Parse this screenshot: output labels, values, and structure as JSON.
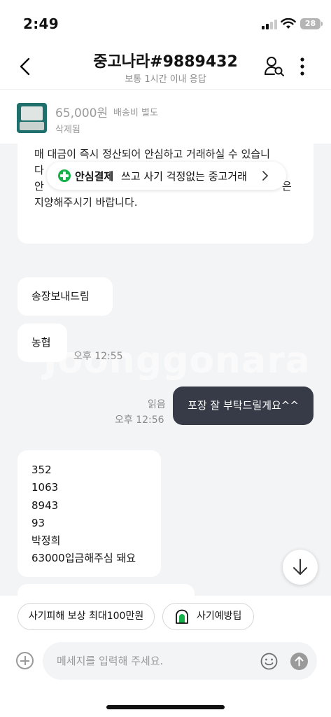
{
  "status_bar": {
    "time": "2:49",
    "battery": "28"
  },
  "header": {
    "title": "중고나라#9889432",
    "subtitle": "보통 1시간 이내 응답",
    "icons": [
      "back-arrow-icon",
      "user-search-icon",
      "more-vertical-icon"
    ]
  },
  "product": {
    "price": "65,000원",
    "shipping": "배송비 별도",
    "status": "삭제됨"
  },
  "banner": {
    "bold": "안심결제",
    "text": "쓰고 사기 걱정없는 중고거래",
    "accent_color": "#16b14a"
  },
  "messages": {
    "notice_lines": [
      "매 대금이 즉시 정산되어 안심하고 거래하실 수 있습니",
      "다",
      "안",
      "지양해주시기 바랍니다."
    ],
    "notice_fragment_right": "은",
    "incoming_1": "송장보내드림",
    "incoming_2": "농협",
    "incoming_time": "오후 12:55",
    "outgoing_text": "포장 잘 부탁드릴게요^^",
    "outgoing_read": "읽음",
    "outgoing_time": "오후 12:56",
    "incoming_3_lines": [
      "352",
      "1063",
      "8943",
      "93",
      "박정희",
      "63000입금해주심 돼요"
    ],
    "watermark": "Joonggonara"
  },
  "chips": {
    "chip_1": "사기피해 보상 최대100만원",
    "chip_2": "사기예방팁"
  },
  "composer": {
    "placeholder": "메세지를 입력해 주세요.",
    "value": ""
  },
  "colors": {
    "outgoing_bubble": "#363b47",
    "chat_background": "#f3f4f6"
  }
}
